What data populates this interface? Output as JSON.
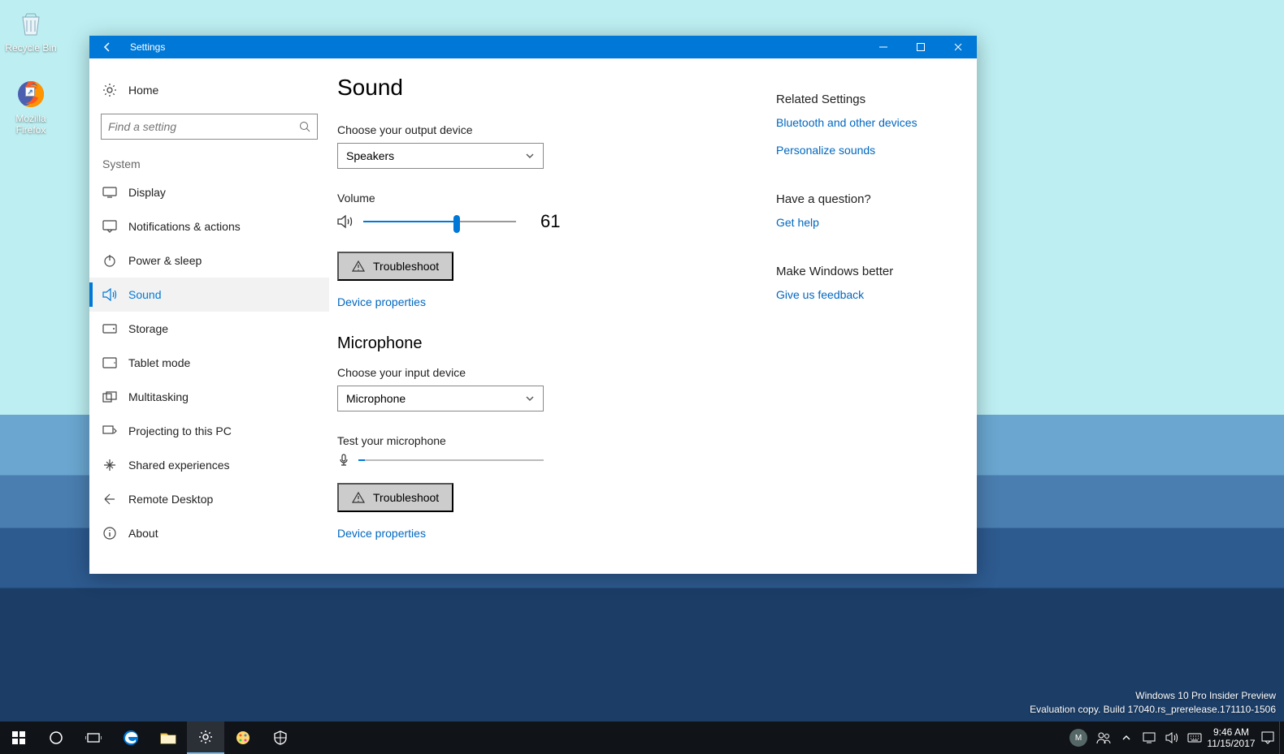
{
  "desktop": {
    "recycle_label": "Recycle Bin",
    "firefox_label": "Mozilla Firefox"
  },
  "window": {
    "title": "Settings",
    "home_label": "Home",
    "search_placeholder": "Find a setting",
    "category": "System",
    "nav": [
      {
        "icon": "display",
        "label": "Display"
      },
      {
        "icon": "notifications",
        "label": "Notifications & actions"
      },
      {
        "icon": "power",
        "label": "Power & sleep"
      },
      {
        "icon": "sound",
        "label": "Sound",
        "selected": true
      },
      {
        "icon": "storage",
        "label": "Storage"
      },
      {
        "icon": "tablet",
        "label": "Tablet mode"
      },
      {
        "icon": "multitask",
        "label": "Multitasking"
      },
      {
        "icon": "project",
        "label": "Projecting to this PC"
      },
      {
        "icon": "shared",
        "label": "Shared experiences"
      },
      {
        "icon": "remote",
        "label": "Remote Desktop"
      },
      {
        "icon": "about",
        "label": "About"
      }
    ]
  },
  "content": {
    "page_title": "Sound",
    "output_label": "Choose your output device",
    "output_value": "Speakers",
    "volume_label": "Volume",
    "volume_value": "61",
    "volume_percent": 61,
    "troubleshoot": "Troubleshoot",
    "device_properties": "Device properties",
    "mic_heading": "Microphone",
    "input_label": "Choose your input device",
    "input_value": "Microphone",
    "test_mic": "Test your microphone"
  },
  "right": {
    "related_heading": "Related Settings",
    "bluetooth": "Bluetooth and other devices",
    "personalize": "Personalize sounds",
    "question_heading": "Have a question?",
    "get_help": "Get help",
    "better_heading": "Make Windows better",
    "feedback": "Give us feedback"
  },
  "taskbar": {
    "time": "9:46 AM",
    "date": "11/15/2017",
    "user_initial": "M"
  },
  "watermark": {
    "line1": "Windows 10 Pro Insider Preview",
    "line2": "Evaluation copy. Build 17040.rs_prerelease.171110-1506"
  }
}
